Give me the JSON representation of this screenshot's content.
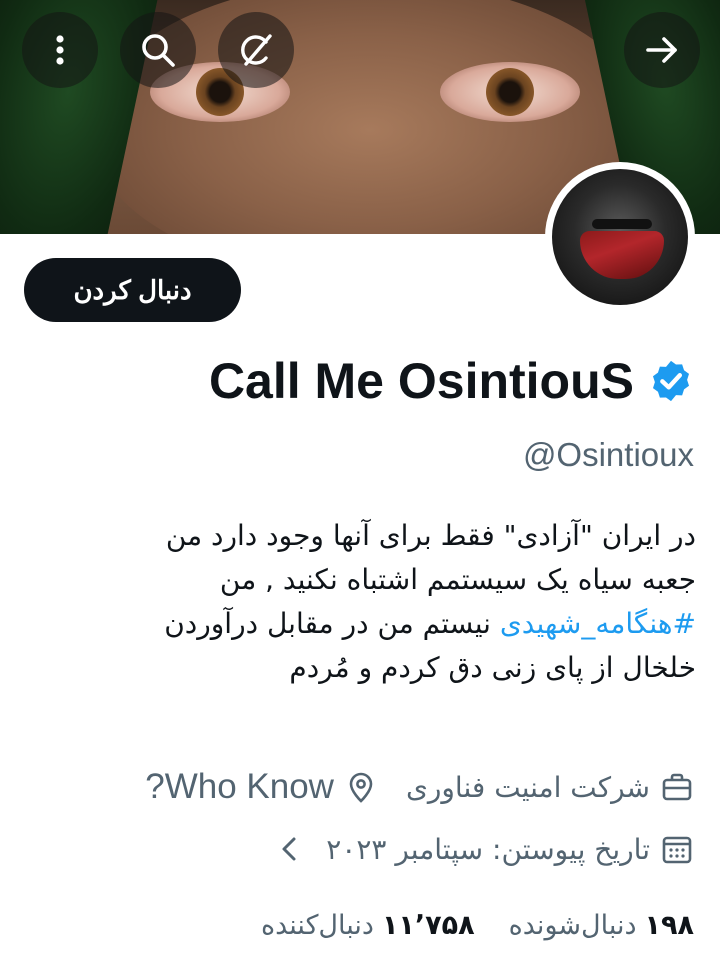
{
  "header": {
    "banner_alt": "banner-photo",
    "buttons": [
      "more-icon",
      "search-icon",
      "grok-icon",
      "forward-arrow-icon"
    ]
  },
  "profile": {
    "follow_label": "دنبال کردن",
    "display_name": "Call Me OsintiouS",
    "verified": true,
    "handle": "@Osintioux",
    "bio_line1": "در ایران \"آزادی\" فقط برای آنها وجود دارد  من",
    "bio_line2": "جعبه سیاه یک سیستمم  اشتباه نکنید , من",
    "bio_hashtag": "#هنگامه_شهیدی",
    "bio_line3_rest": " نیستم  من در مقابل درآوردن",
    "bio_line4": "خلخال از پای زنی دق کردم  و مُردم",
    "category": "شرکت امنیت فناوری",
    "location": "Who Know?",
    "joined": "تاریخ پیوستن: سپتامبر ۲۰۲۳",
    "following_count": "۱۹۸",
    "following_label": "دنبال‌شونده",
    "followers_count": "۱۱٬۷۵۸",
    "followers_label": "دنبال‌کننده"
  },
  "colors": {
    "accent": "#1d9bf0",
    "text": "#0f1419",
    "muted": "#536471"
  }
}
